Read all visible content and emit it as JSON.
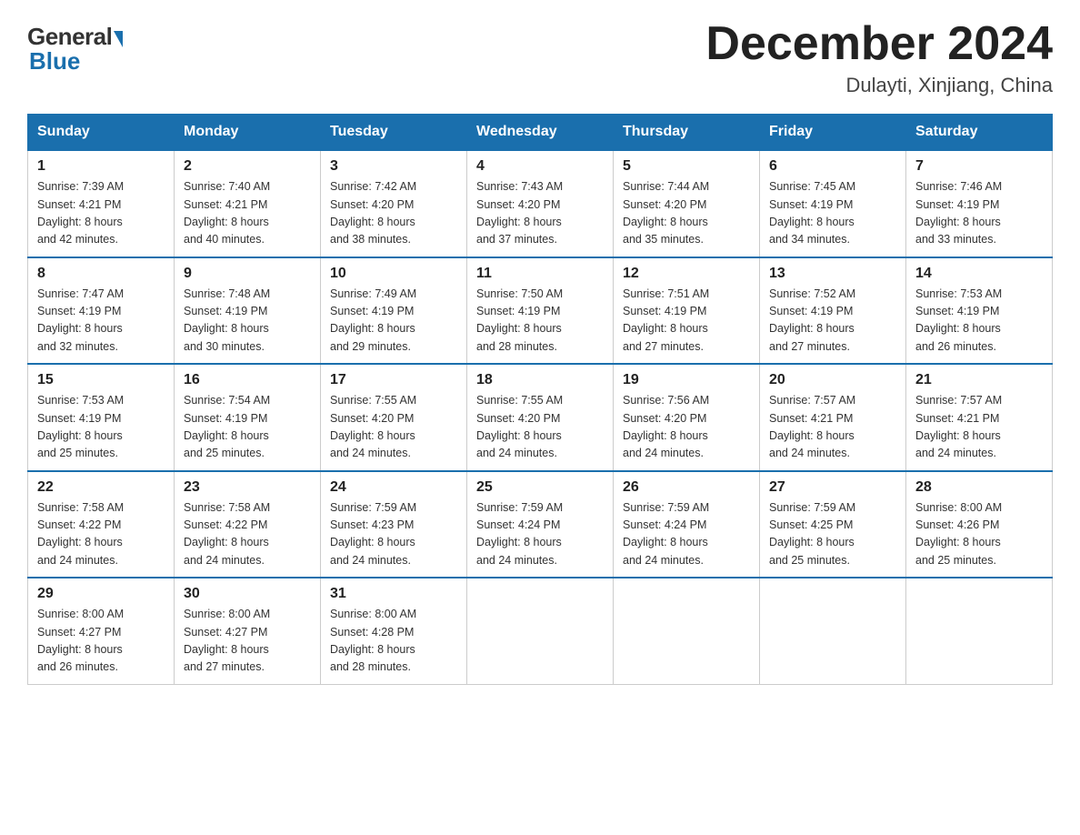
{
  "header": {
    "logo_general": "General",
    "logo_blue": "Blue",
    "month_title": "December 2024",
    "location": "Dulayti, Xinjiang, China"
  },
  "weekdays": [
    "Sunday",
    "Monday",
    "Tuesday",
    "Wednesday",
    "Thursday",
    "Friday",
    "Saturday"
  ],
  "weeks": [
    [
      {
        "day": "1",
        "sunrise": "7:39 AM",
        "sunset": "4:21 PM",
        "daylight": "8 hours and 42 minutes."
      },
      {
        "day": "2",
        "sunrise": "7:40 AM",
        "sunset": "4:21 PM",
        "daylight": "8 hours and 40 minutes."
      },
      {
        "day": "3",
        "sunrise": "7:42 AM",
        "sunset": "4:20 PM",
        "daylight": "8 hours and 38 minutes."
      },
      {
        "day": "4",
        "sunrise": "7:43 AM",
        "sunset": "4:20 PM",
        "daylight": "8 hours and 37 minutes."
      },
      {
        "day": "5",
        "sunrise": "7:44 AM",
        "sunset": "4:20 PM",
        "daylight": "8 hours and 35 minutes."
      },
      {
        "day": "6",
        "sunrise": "7:45 AM",
        "sunset": "4:19 PM",
        "daylight": "8 hours and 34 minutes."
      },
      {
        "day": "7",
        "sunrise": "7:46 AM",
        "sunset": "4:19 PM",
        "daylight": "8 hours and 33 minutes."
      }
    ],
    [
      {
        "day": "8",
        "sunrise": "7:47 AM",
        "sunset": "4:19 PM",
        "daylight": "8 hours and 32 minutes."
      },
      {
        "day": "9",
        "sunrise": "7:48 AM",
        "sunset": "4:19 PM",
        "daylight": "8 hours and 30 minutes."
      },
      {
        "day": "10",
        "sunrise": "7:49 AM",
        "sunset": "4:19 PM",
        "daylight": "8 hours and 29 minutes."
      },
      {
        "day": "11",
        "sunrise": "7:50 AM",
        "sunset": "4:19 PM",
        "daylight": "8 hours and 28 minutes."
      },
      {
        "day": "12",
        "sunrise": "7:51 AM",
        "sunset": "4:19 PM",
        "daylight": "8 hours and 27 minutes."
      },
      {
        "day": "13",
        "sunrise": "7:52 AM",
        "sunset": "4:19 PM",
        "daylight": "8 hours and 27 minutes."
      },
      {
        "day": "14",
        "sunrise": "7:53 AM",
        "sunset": "4:19 PM",
        "daylight": "8 hours and 26 minutes."
      }
    ],
    [
      {
        "day": "15",
        "sunrise": "7:53 AM",
        "sunset": "4:19 PM",
        "daylight": "8 hours and 25 minutes."
      },
      {
        "day": "16",
        "sunrise": "7:54 AM",
        "sunset": "4:19 PM",
        "daylight": "8 hours and 25 minutes."
      },
      {
        "day": "17",
        "sunrise": "7:55 AM",
        "sunset": "4:20 PM",
        "daylight": "8 hours and 24 minutes."
      },
      {
        "day": "18",
        "sunrise": "7:55 AM",
        "sunset": "4:20 PM",
        "daylight": "8 hours and 24 minutes."
      },
      {
        "day": "19",
        "sunrise": "7:56 AM",
        "sunset": "4:20 PM",
        "daylight": "8 hours and 24 minutes."
      },
      {
        "day": "20",
        "sunrise": "7:57 AM",
        "sunset": "4:21 PM",
        "daylight": "8 hours and 24 minutes."
      },
      {
        "day": "21",
        "sunrise": "7:57 AM",
        "sunset": "4:21 PM",
        "daylight": "8 hours and 24 minutes."
      }
    ],
    [
      {
        "day": "22",
        "sunrise": "7:58 AM",
        "sunset": "4:22 PM",
        "daylight": "8 hours and 24 minutes."
      },
      {
        "day": "23",
        "sunrise": "7:58 AM",
        "sunset": "4:22 PM",
        "daylight": "8 hours and 24 minutes."
      },
      {
        "day": "24",
        "sunrise": "7:59 AM",
        "sunset": "4:23 PM",
        "daylight": "8 hours and 24 minutes."
      },
      {
        "day": "25",
        "sunrise": "7:59 AM",
        "sunset": "4:24 PM",
        "daylight": "8 hours and 24 minutes."
      },
      {
        "day": "26",
        "sunrise": "7:59 AM",
        "sunset": "4:24 PM",
        "daylight": "8 hours and 24 minutes."
      },
      {
        "day": "27",
        "sunrise": "7:59 AM",
        "sunset": "4:25 PM",
        "daylight": "8 hours and 25 minutes."
      },
      {
        "day": "28",
        "sunrise": "8:00 AM",
        "sunset": "4:26 PM",
        "daylight": "8 hours and 25 minutes."
      }
    ],
    [
      {
        "day": "29",
        "sunrise": "8:00 AM",
        "sunset": "4:27 PM",
        "daylight": "8 hours and 26 minutes."
      },
      {
        "day": "30",
        "sunrise": "8:00 AM",
        "sunset": "4:27 PM",
        "daylight": "8 hours and 27 minutes."
      },
      {
        "day": "31",
        "sunrise": "8:00 AM",
        "sunset": "4:28 PM",
        "daylight": "8 hours and 28 minutes."
      },
      null,
      null,
      null,
      null
    ]
  ],
  "labels": {
    "sunrise": "Sunrise: ",
    "sunset": "Sunset: ",
    "daylight": "Daylight: "
  }
}
